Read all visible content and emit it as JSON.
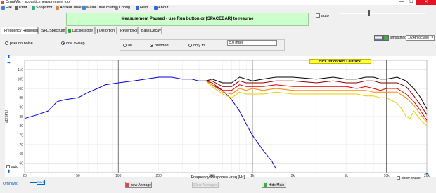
{
  "window": {
    "title": "OmniMic - acoustic measurement tool",
    "minimize": "—",
    "maximize": "☐",
    "close": "✕"
  },
  "menu": [
    {
      "label": "File",
      "icon": "file-icon",
      "color": "#4a7bd0"
    },
    {
      "label": "Print",
      "icon": "print-icon",
      "color": "#666"
    },
    {
      "label": "Snapshot",
      "icon": "snapshot-icon",
      "color": "#3a8"
    },
    {
      "label": "AddedCurves",
      "icon": "added-curves-icon",
      "color": "#c84"
    },
    {
      "label": "MainCurve math",
      "icon": "math-icon",
      "color": "#48c"
    },
    {
      "label": "Config",
      "icon": "config-icon",
      "color": "#888"
    },
    {
      "label": "Help",
      "icon": "help-icon",
      "color": "#36c"
    },
    {
      "label": "About",
      "icon": "about-icon",
      "color": "#36c"
    }
  ],
  "banner": {
    "message": "Measurement Paused - use Run button or [SPACEBAR] to resume"
  },
  "auto_checkbox": {
    "label": "auto",
    "checked": false
  },
  "tabs": [
    {
      "label": "Frequency Response",
      "icon": "frequency-icon",
      "color": "#2a5db0",
      "active": true
    },
    {
      "label": "SPL/Spectrum",
      "icon": "spectrum-icon",
      "color": "#cc2",
      "active": false
    },
    {
      "label": "Oscilloscope",
      "icon": "oscilloscope-icon",
      "color": "#2a2",
      "active": false
    },
    {
      "label": "Distortion",
      "icon": "distortion-icon",
      "color": "#c33",
      "active": false
    },
    {
      "label": "Reverb/RTC",
      "icon": "reverb-icon",
      "color": "#36c",
      "active": false
    },
    {
      "label": "Bass Decay",
      "icon": "bass-decay-icon",
      "color": "#369",
      "active": false
    }
  ],
  "signal_options": [
    {
      "label": "pseudo noise",
      "selected": false
    },
    {
      "label": "one sweep",
      "selected": true
    }
  ],
  "gating_options": [
    {
      "label": "all",
      "selected": false
    },
    {
      "label": "blended",
      "selected": true
    },
    {
      "label": "only to",
      "selected": false
    }
  ],
  "gate_time": "5.0 msec",
  "smoothing": {
    "label": "smoothing",
    "value": "1/24th octave"
  },
  "hint": "click for correct CD track!",
  "y_axis": {
    "unit": "dB[SPL]",
    "min": 55,
    "max": 115,
    "ticks": [
      110,
      105,
      100,
      95,
      90,
      85,
      80,
      75,
      70,
      65,
      60
    ]
  },
  "x_axis": {
    "label": "Frequency Response -freq [Hz]",
    "ticks": [
      "20",
      "50",
      "100",
      "200",
      "500",
      "1k",
      "2k",
      "5k",
      "10k",
      "20k"
    ]
  },
  "chart_data": {
    "type": "line",
    "xlabel": "Frequency Response -freq [Hz]",
    "ylabel": "dB[SPL]",
    "xscale": "log",
    "xlim": [
      20,
      20000
    ],
    "ylim": [
      55,
      115
    ],
    "grid": true,
    "series": [
      {
        "color": "#0000dd",
        "points": [
          [
            20,
            84
          ],
          [
            25,
            86
          ],
          [
            30,
            88
          ],
          [
            35,
            93
          ],
          [
            40,
            94
          ],
          [
            50,
            95
          ],
          [
            60,
            98
          ],
          [
            70,
            100
          ],
          [
            80,
            102
          ],
          [
            100,
            103
          ],
          [
            130,
            104
          ],
          [
            160,
            105
          ],
          [
            200,
            106
          ],
          [
            250,
            106
          ],
          [
            300,
            105
          ],
          [
            350,
            105
          ],
          [
            400,
            104
          ],
          [
            450,
            104
          ],
          [
            500,
            102
          ],
          [
            600,
            99
          ],
          [
            700,
            94
          ],
          [
            800,
            88
          ],
          [
            900,
            81
          ],
          [
            1000,
            75
          ],
          [
            1200,
            67
          ],
          [
            1400,
            61
          ],
          [
            1500,
            57
          ]
        ]
      },
      {
        "color": "#000000",
        "points": [
          [
            450,
            104
          ],
          [
            500,
            105
          ],
          [
            600,
            103
          ],
          [
            700,
            103
          ],
          [
            800,
            106
          ],
          [
            900,
            105
          ],
          [
            1000,
            104
          ],
          [
            1200,
            105
          ],
          [
            1500,
            106
          ],
          [
            2000,
            106
          ],
          [
            3000,
            105
          ],
          [
            4000,
            106
          ],
          [
            5000,
            105
          ],
          [
            6000,
            105
          ],
          [
            7000,
            106
          ],
          [
            8000,
            106
          ],
          [
            9000,
            105
          ],
          [
            10000,
            105
          ],
          [
            12000,
            106
          ],
          [
            14000,
            104
          ],
          [
            16000,
            100
          ],
          [
            18000,
            95
          ],
          [
            20000,
            89
          ]
        ]
      },
      {
        "color": "#880000",
        "points": [
          [
            450,
            104
          ],
          [
            500,
            104
          ],
          [
            600,
            101
          ],
          [
            700,
            101
          ],
          [
            800,
            104
          ],
          [
            900,
            103
          ],
          [
            1000,
            103
          ],
          [
            1200,
            103
          ],
          [
            1500,
            104
          ],
          [
            2000,
            104
          ],
          [
            3000,
            103
          ],
          [
            4000,
            104
          ],
          [
            5000,
            103
          ],
          [
            6000,
            103
          ],
          [
            7000,
            104
          ],
          [
            8000,
            104
          ],
          [
            9000,
            103
          ],
          [
            10000,
            103
          ],
          [
            12000,
            103
          ],
          [
            14000,
            101
          ],
          [
            16000,
            96
          ],
          [
            18000,
            91
          ],
          [
            20000,
            86
          ]
        ]
      },
      {
        "color": "#dd0000",
        "points": [
          [
            450,
            104
          ],
          [
            500,
            103
          ],
          [
            600,
            99
          ],
          [
            700,
            99
          ],
          [
            800,
            102
          ],
          [
            900,
            101
          ],
          [
            1000,
            101
          ],
          [
            1200,
            101
          ],
          [
            1500,
            102
          ],
          [
            2000,
            101
          ],
          [
            3000,
            101
          ],
          [
            4000,
            101
          ],
          [
            5000,
            101
          ],
          [
            6000,
            100
          ],
          [
            7000,
            101
          ],
          [
            8000,
            100
          ],
          [
            9000,
            99
          ],
          [
            10000,
            100
          ],
          [
            12000,
            100
          ],
          [
            14000,
            97
          ],
          [
            16000,
            93
          ],
          [
            18000,
            88
          ],
          [
            20000,
            83
          ]
        ]
      },
      {
        "color": "#ff8800",
        "points": [
          [
            450,
            104
          ],
          [
            500,
            102
          ],
          [
            600,
            98
          ],
          [
            700,
            97
          ],
          [
            800,
            100
          ],
          [
            900,
            99
          ],
          [
            1000,
            100
          ],
          [
            1200,
            99
          ],
          [
            1500,
            100
          ],
          [
            2000,
            99
          ],
          [
            3000,
            99
          ],
          [
            4000,
            99
          ],
          [
            5000,
            99
          ],
          [
            6000,
            99
          ],
          [
            7000,
            99
          ],
          [
            8000,
            98
          ],
          [
            9000,
            98
          ],
          [
            10000,
            98
          ],
          [
            12000,
            98
          ],
          [
            14000,
            95
          ],
          [
            16000,
            91
          ],
          [
            18000,
            86
          ],
          [
            20000,
            82
          ]
        ]
      },
      {
        "color": "#eecc00",
        "points": [
          [
            450,
            104
          ],
          [
            500,
            101
          ],
          [
            600,
            97
          ],
          [
            700,
            95
          ],
          [
            800,
            98
          ],
          [
            900,
            97
          ],
          [
            1000,
            97
          ],
          [
            1200,
            97
          ],
          [
            1500,
            98
          ],
          [
            2000,
            97
          ],
          [
            3000,
            97
          ],
          [
            4000,
            97
          ],
          [
            5000,
            97
          ],
          [
            6000,
            97
          ],
          [
            7000,
            96
          ],
          [
            8000,
            96
          ],
          [
            9000,
            95
          ],
          [
            10000,
            95
          ],
          [
            12000,
            92
          ],
          [
            13000,
            89
          ],
          [
            14000,
            85
          ],
          [
            15000,
            84
          ],
          [
            16000,
            88
          ],
          [
            18000,
            83
          ],
          [
            20000,
            80
          ]
        ]
      }
    ]
  },
  "side_auto": {
    "label": "auto",
    "checked": true
  },
  "show_phase": {
    "label": "show phase",
    "checked": false
  },
  "bottom": {
    "logo": "OmniMic",
    "mode": "SAVE",
    "new_average": "new Average",
    "clear_averages": "Clear Averages",
    "hide_main": "Hide Main"
  },
  "colors": {
    "banner_bg": "#ccffcc",
    "hint_bg": "#ffff33",
    "accent": "#06c"
  }
}
